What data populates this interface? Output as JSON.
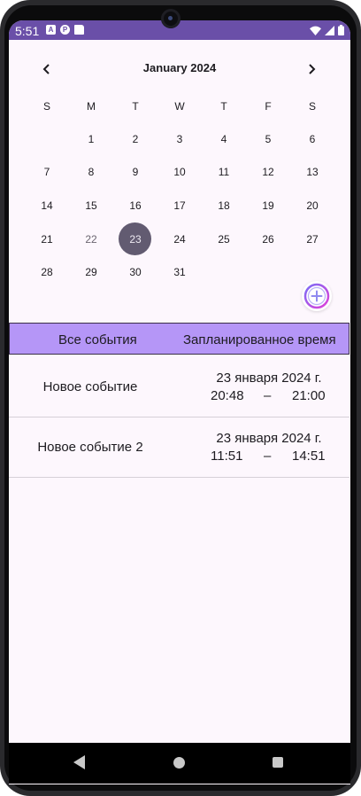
{
  "status_bar": {
    "time": "5:51",
    "left_icons": [
      "a-icon",
      "p-icon",
      "sd-card-icon"
    ],
    "right_icons": [
      "wifi-icon",
      "signal-icon",
      "battery-icon"
    ]
  },
  "calendar": {
    "month_title": "January 2024",
    "prev_icon": "chevron-left-icon",
    "next_icon": "chevron-right-icon",
    "weekdays": [
      "S",
      "M",
      "T",
      "W",
      "T",
      "F",
      "S"
    ],
    "weeks": [
      [
        "",
        "1",
        "2",
        "3",
        "4",
        "5",
        "6"
      ],
      [
        "7",
        "8",
        "9",
        "10",
        "11",
        "12",
        "13"
      ],
      [
        "14",
        "15",
        "16",
        "17",
        "18",
        "19",
        "20"
      ],
      [
        "21",
        "22",
        "23",
        "24",
        "25",
        "26",
        "27"
      ],
      [
        "28",
        "29",
        "30",
        "31",
        "",
        "",
        ""
      ]
    ],
    "today": "22",
    "selected": "23",
    "selected_color": "#625b71"
  },
  "fab": {
    "icon": "plus-circle-icon"
  },
  "table": {
    "header_all": "Все события",
    "header_time": "Запланированное время",
    "header_color": "#b596f7",
    "rows": [
      {
        "name": "Новое событие",
        "date": "23 января 2024 г.",
        "start": "20:48",
        "dash": "–",
        "end": "21:00"
      },
      {
        "name": "Новое событие 2",
        "date": "23 января 2024 г.",
        "start": "11:51",
        "dash": "–",
        "end": "14:51"
      }
    ]
  },
  "nav_bar": {
    "icons": [
      "back-icon",
      "home-icon",
      "recents-icon"
    ]
  },
  "colors": {
    "status_bar": "#6a4fa8",
    "background": "#fdf7fd"
  }
}
